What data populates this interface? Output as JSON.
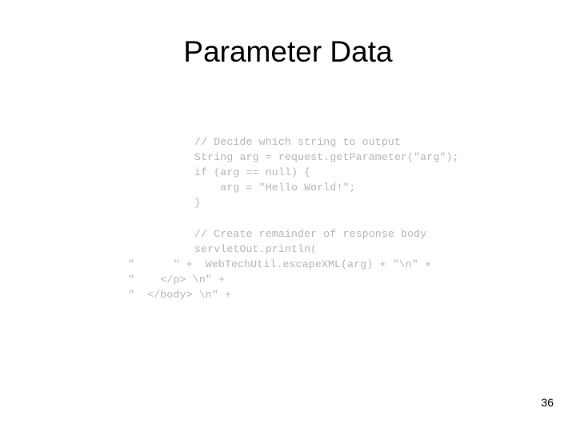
{
  "slide": {
    "background_color": "#ffffff",
    "title": "Parameter Data",
    "title_color": "#000000",
    "page_number": "36",
    "page_number_color": "#000000"
  },
  "code": {
    "color": "#b6b6b6",
    "language": "java",
    "lines": [
      {
        "text": "// Decide which string to output",
        "style": "indent"
      },
      {
        "text": "String arg = request.getParameter(\"arg\");",
        "style": "indent"
      },
      {
        "text": "if (arg == null) {",
        "style": "indent"
      },
      {
        "text": "    arg = \"Hello World!\";",
        "style": "indent"
      },
      {
        "text": "}",
        "style": "indent"
      },
      {
        "text": " ",
        "style": "blank"
      },
      {
        "text": "// Create remainder of response body",
        "style": "indent"
      },
      {
        "text": "servletOut.println(",
        "style": "indent"
      },
      {
        "text": "\"      \" +  WebTechUtil.escapeXML(arg) + \"\\n\" +",
        "style": "hang"
      },
      {
        "text": "\"    </p> \\n\" +",
        "style": "hang"
      },
      {
        "text": "\"  </body> \\n\" +",
        "style": "hang"
      }
    ]
  }
}
